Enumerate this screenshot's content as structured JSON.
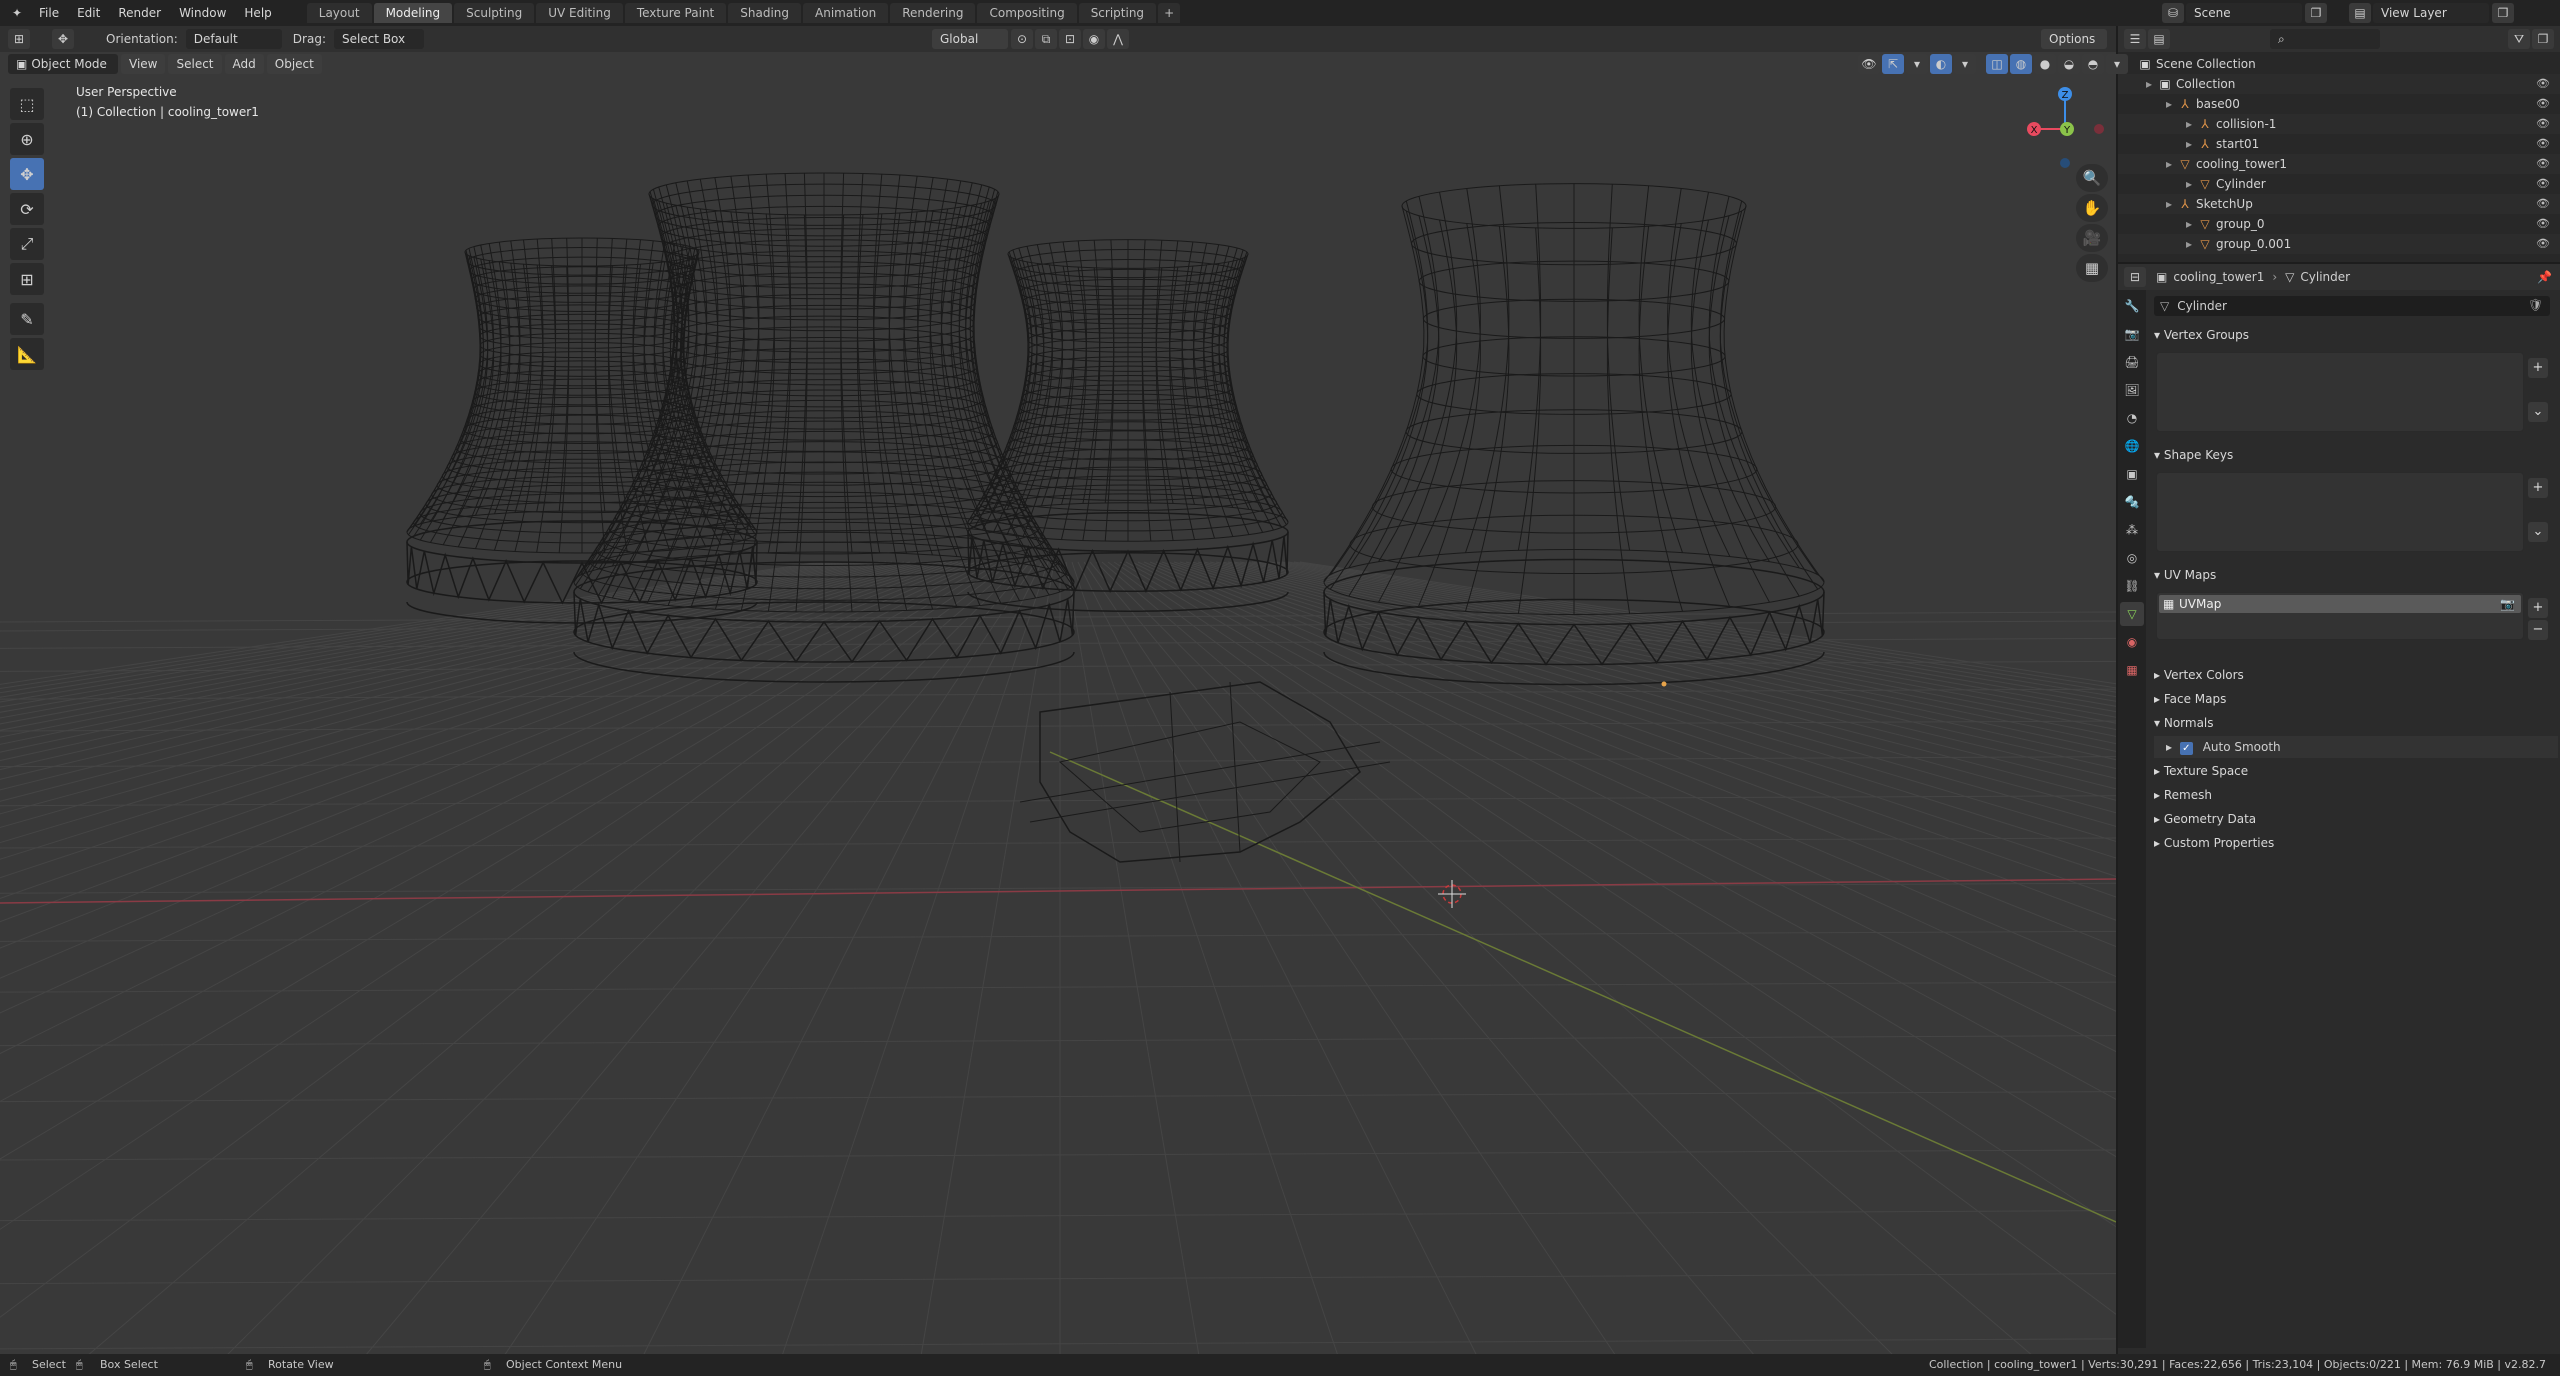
{
  "topbar": {
    "menus": [
      "File",
      "Edit",
      "Render",
      "Window",
      "Help"
    ],
    "workspaces": [
      "Layout",
      "Modeling",
      "Sculpting",
      "UV Editing",
      "Texture Paint",
      "Shading",
      "Animation",
      "Rendering",
      "Compositing",
      "Scripting"
    ],
    "active_workspace": "Modeling",
    "scene": "Scene",
    "view_layer": "View Layer"
  },
  "tool_header": {
    "orientation_label": "Orientation:",
    "orientation_value": "Default",
    "drag_label": "Drag:",
    "drag_value": "Select Box",
    "transform_space": "Global",
    "options": "Options"
  },
  "view_header": {
    "mode": "Object Mode",
    "menus": [
      "View",
      "Select",
      "Add",
      "Object"
    ]
  },
  "viewport": {
    "perspective": "User Perspective",
    "collection_info": "(1) Collection | cooling_tower1",
    "axes": {
      "x": "X",
      "y": "Y",
      "z": "Z"
    }
  },
  "outliner": {
    "rows": [
      {
        "label": "Scene Collection",
        "indent": 0,
        "icon": "▣"
      },
      {
        "label": "Collection",
        "indent": 1,
        "icon": "▣"
      },
      {
        "label": "base00",
        "indent": 2,
        "icon": "⅄"
      },
      {
        "label": "collision-1",
        "indent": 3,
        "icon": "⅄"
      },
      {
        "label": "start01",
        "indent": 3,
        "icon": "⅄"
      },
      {
        "label": "cooling_tower1",
        "indent": 2,
        "icon": "▽"
      },
      {
        "label": "Cylinder",
        "indent": 3,
        "icon": "▽"
      },
      {
        "label": "SketchUp",
        "indent": 2,
        "icon": "⅄"
      },
      {
        "label": "group_0",
        "indent": 3,
        "icon": "▽"
      },
      {
        "label": "group_0.001",
        "indent": 3,
        "icon": "▽"
      }
    ]
  },
  "properties": {
    "breadcrumb_object": "cooling_tower1",
    "breadcrumb_data": "Cylinder",
    "data_name": "Cylinder",
    "panels": {
      "vertex_groups": "Vertex Groups",
      "shape_keys": "Shape Keys",
      "uv_maps": "UV Maps",
      "uv_map_item": "UVMap",
      "vertex_colors": "Vertex Colors",
      "face_maps": "Face Maps",
      "normals": "Normals",
      "auto_smooth": "Auto Smooth",
      "texture_space": "Texture Space",
      "remesh": "Remesh",
      "geometry_data": "Geometry Data",
      "custom_properties": "Custom Properties"
    }
  },
  "statusbar": {
    "select": "Select",
    "box_select": "Box Select",
    "rotate_view": "Rotate View",
    "context_menu": "Object Context Menu",
    "stats": "Collection | cooling_tower1 | Verts:30,291 | Faces:22,656 | Tris:23,104 | Objects:0/221 | Mem: 76.9 MiB | v2.82.7"
  },
  "colors": {
    "accent": "#4772b3",
    "x_axis": "#e84a5f",
    "y_axis": "#8bc34a",
    "z_axis": "#3d8ee8"
  }
}
